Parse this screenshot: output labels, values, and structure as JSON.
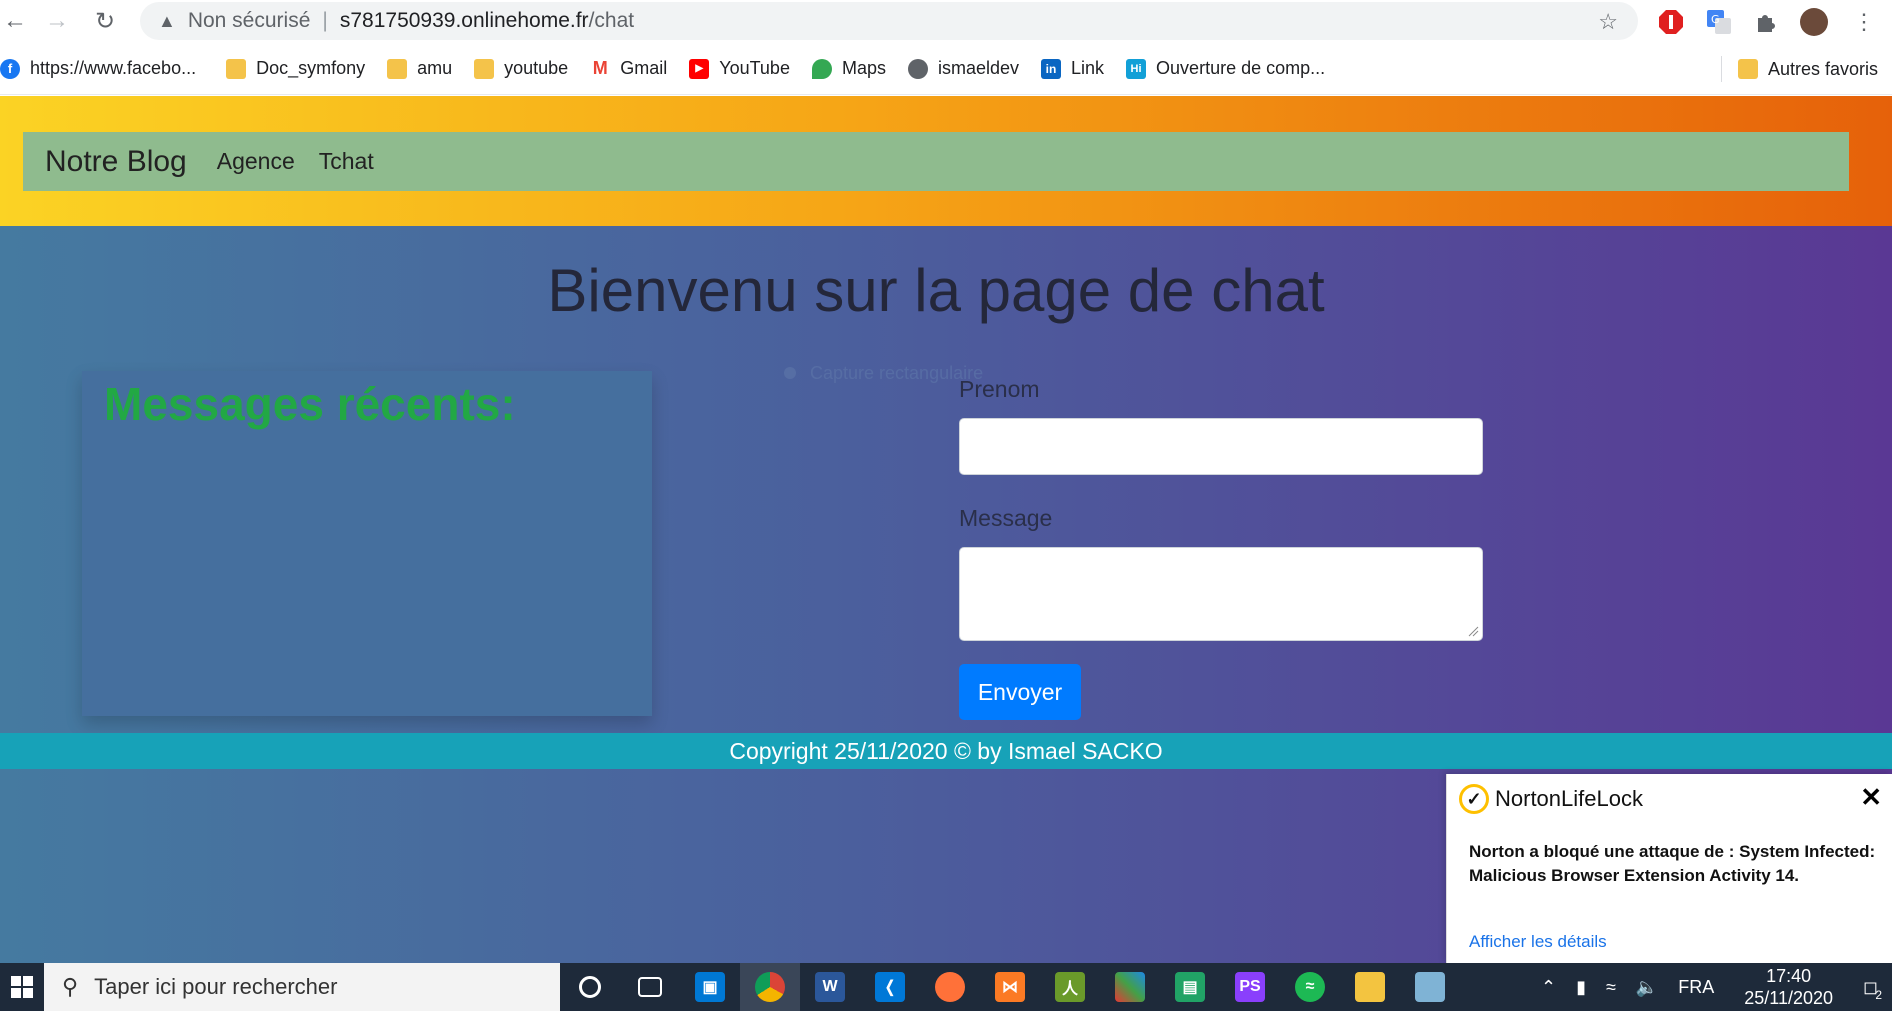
{
  "browser": {
    "security_label": "Non sécurisé",
    "separator": "|",
    "url_host": "s781750939.onlinehome.fr",
    "url_path": "/chat"
  },
  "bookmarks": [
    {
      "label": "https://www.facebo...",
      "icon": "facebook-icon"
    },
    {
      "label": "Doc_symfony",
      "icon": "folder-icon"
    },
    {
      "label": "amu",
      "icon": "folder-icon"
    },
    {
      "label": "youtube",
      "icon": "folder-icon"
    },
    {
      "label": "Gmail",
      "icon": "gmail-icon"
    },
    {
      "label": "YouTube",
      "icon": "youtube-icon"
    },
    {
      "label": "Maps",
      "icon": "maps-icon"
    },
    {
      "label": "ismaeldev",
      "icon": "globe-icon"
    },
    {
      "label": "Link",
      "icon": "linkedin-icon"
    },
    {
      "label": "Ouverture de comp...",
      "icon": "hi-icon"
    }
  ],
  "other_bookmarks": "Autres favoris",
  "navbar": {
    "brand": "Notre Blog",
    "links": [
      "Agence",
      "Tchat"
    ]
  },
  "page": {
    "title": "Bienvenu sur la page de chat",
    "recent_title": "Messages récents:",
    "capture_overlay": "Capture rectangulaire"
  },
  "form": {
    "prenom_label": "Prenom",
    "message_label": "Message",
    "submit_label": "Envoyer"
  },
  "footer": {
    "text": "Copyright 25/11/2020 © by Ismael SACKO"
  },
  "norton": {
    "brand": "NortonLifeLock",
    "message": "Norton a bloqué une attaque de : System Infected: Malicious Browser Extension Activity 14.",
    "details_link": "Afficher les détails"
  },
  "taskbar": {
    "search_placeholder": "Taper ici pour rechercher",
    "language": "FRA",
    "time": "17:40",
    "date": "25/11/2020",
    "notifications": "2"
  },
  "colors": {
    "header_gradient": [
      "#fbd324",
      "#e6610a"
    ],
    "page_gradient": [
      "#457aa0",
      "#5a3894"
    ],
    "navbar": "#8fbb8e",
    "recent_title": "#22a844",
    "send_button": "#007bff",
    "footer": "#17a2b8"
  }
}
